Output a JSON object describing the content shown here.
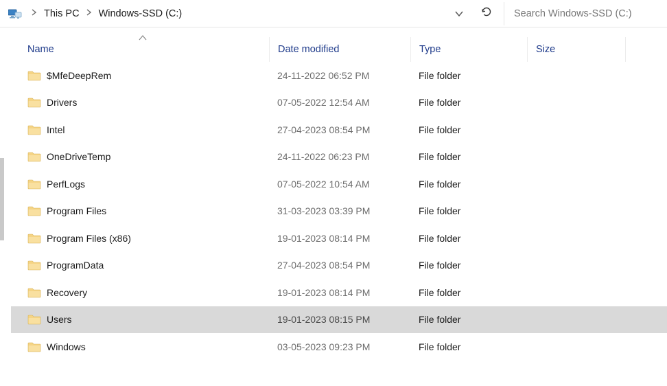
{
  "breadcrumb": {
    "crumb1": "This PC",
    "crumb2": "Windows-SSD (C:)"
  },
  "search": {
    "placeholder": "Search Windows-SSD (C:)"
  },
  "columns": {
    "name": "Name",
    "date": "Date modified",
    "type": "Type",
    "size": "Size"
  },
  "rows": [
    {
      "name": "$MfeDeepRem",
      "date": "24-11-2022 06:52 PM",
      "type": "File folder",
      "selected": false
    },
    {
      "name": "Drivers",
      "date": "07-05-2022 12:54 AM",
      "type": "File folder",
      "selected": false
    },
    {
      "name": "Intel",
      "date": "27-04-2023 08:54 PM",
      "type": "File folder",
      "selected": false
    },
    {
      "name": "OneDriveTemp",
      "date": "24-11-2022 06:23 PM",
      "type": "File folder",
      "selected": false
    },
    {
      "name": "PerfLogs",
      "date": "07-05-2022 10:54 AM",
      "type": "File folder",
      "selected": false
    },
    {
      "name": "Program Files",
      "date": "31-03-2023 03:39 PM",
      "type": "File folder",
      "selected": false
    },
    {
      "name": "Program Files (x86)",
      "date": "19-01-2023 08:14 PM",
      "type": "File folder",
      "selected": false
    },
    {
      "name": "ProgramData",
      "date": "27-04-2023 08:54 PM",
      "type": "File folder",
      "selected": false
    },
    {
      "name": "Recovery",
      "date": "19-01-2023 08:14 PM",
      "type": "File folder",
      "selected": false
    },
    {
      "name": "Users",
      "date": "19-01-2023 08:15 PM",
      "type": "File folder",
      "selected": true
    },
    {
      "name": "Windows",
      "date": "03-05-2023 09:23 PM",
      "type": "File folder",
      "selected": false
    }
  ]
}
